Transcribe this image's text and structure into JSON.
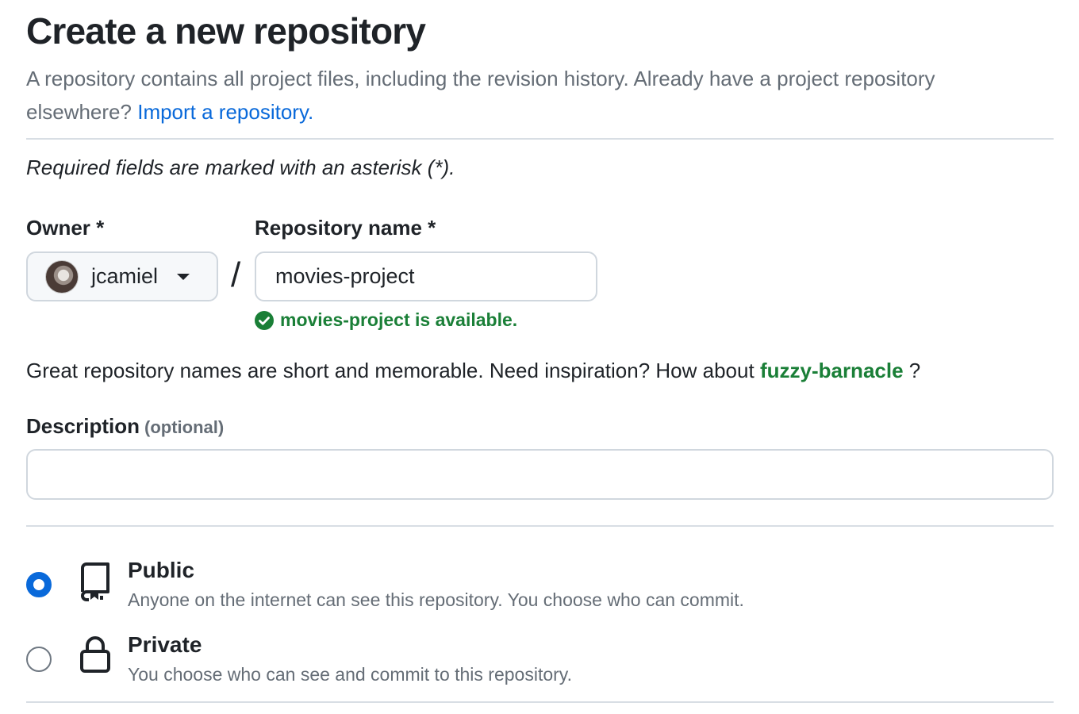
{
  "header": {
    "title": "Create a new repository",
    "intro_text": "A repository contains all project files, including the revision history. Already have a project repository elsewhere?",
    "import_link": "Import a repository."
  },
  "required_note": "Required fields are marked with an asterisk (*).",
  "owner": {
    "label": "Owner *",
    "selected": "jcamiel",
    "avatar_icon": "user-avatar"
  },
  "separator": "/",
  "repository": {
    "label": "Repository name *",
    "value": "movies-project",
    "availability": "movies-project is available.",
    "availability_icon": "check-circle-icon"
  },
  "suggestion": {
    "prefix": "Great repository names are short and memorable. Need inspiration? How about",
    "name": "fuzzy-barnacle",
    "suffix": "?"
  },
  "description": {
    "label": "Description",
    "optional": "(optional)",
    "value": ""
  },
  "visibility": {
    "options": [
      {
        "title": "Public",
        "description": "Anyone on the internet can see this repository. You choose who can commit.",
        "icon": "repo-icon",
        "selected": true
      },
      {
        "title": "Private",
        "description": "You choose who can see and commit to this repository.",
        "icon": "lock-icon",
        "selected": false
      }
    ]
  },
  "colors": {
    "link": "#0969da",
    "success": "#1a7f37",
    "muted_text": "#656d76",
    "border": "#d0d7de",
    "radio_selected": "#0969da"
  }
}
